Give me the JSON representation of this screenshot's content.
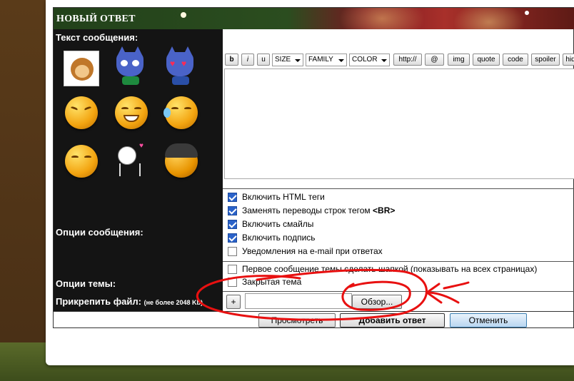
{
  "header": {
    "title": "НОВЫЙ ОТВЕТ"
  },
  "labels": {
    "message_text": "Текст сообщения:",
    "message_options": "Опции сообщения:",
    "topic_options": "Опции темы:",
    "attach_file": "Прикрепить файл:",
    "attach_limit": "(не более 2048 Kb)"
  },
  "smileys": [
    "monkey",
    "blue-cat",
    "cat-heart-eyes",
    "angry",
    "grin",
    "sweat",
    "blush",
    "stick-figure",
    "cool"
  ],
  "toolbar": {
    "bold": "b",
    "italic": "i",
    "underline": "u",
    "size": "SIZE",
    "family": "FAMILY",
    "color": "COLOR",
    "url": "http://",
    "email": "@",
    "img": "img",
    "quote": "quote",
    "code": "code",
    "spoiler": "spoiler",
    "hide": "hid"
  },
  "message": {
    "value": ""
  },
  "message_options": [
    {
      "label": "Включить HTML теги",
      "checked": true
    },
    {
      "label_pre": "Заменять переводы строк тегом ",
      "label_bold": "<BR>",
      "checked": true
    },
    {
      "label": "Включить смайлы",
      "checked": true
    },
    {
      "label": "Включить подпись",
      "checked": true
    },
    {
      "label": "Уведомления на e-mail при ответах",
      "checked": false
    }
  ],
  "topic_options": [
    {
      "label": "Первое сообщение темы сделать шапкой (показывать на всех страницах)",
      "checked": false
    },
    {
      "label": "Закрытая тема",
      "checked": false
    }
  ],
  "attach": {
    "plus": "+",
    "browse": "Обзор...",
    "value": ""
  },
  "actions": {
    "preview": "Просмотреть",
    "submit": "Добавить ответ",
    "cancel": "Отменить"
  },
  "colors": {
    "annotation": "#e81010",
    "header_green": "#2b4d1f",
    "header_red": "#a8302a"
  }
}
